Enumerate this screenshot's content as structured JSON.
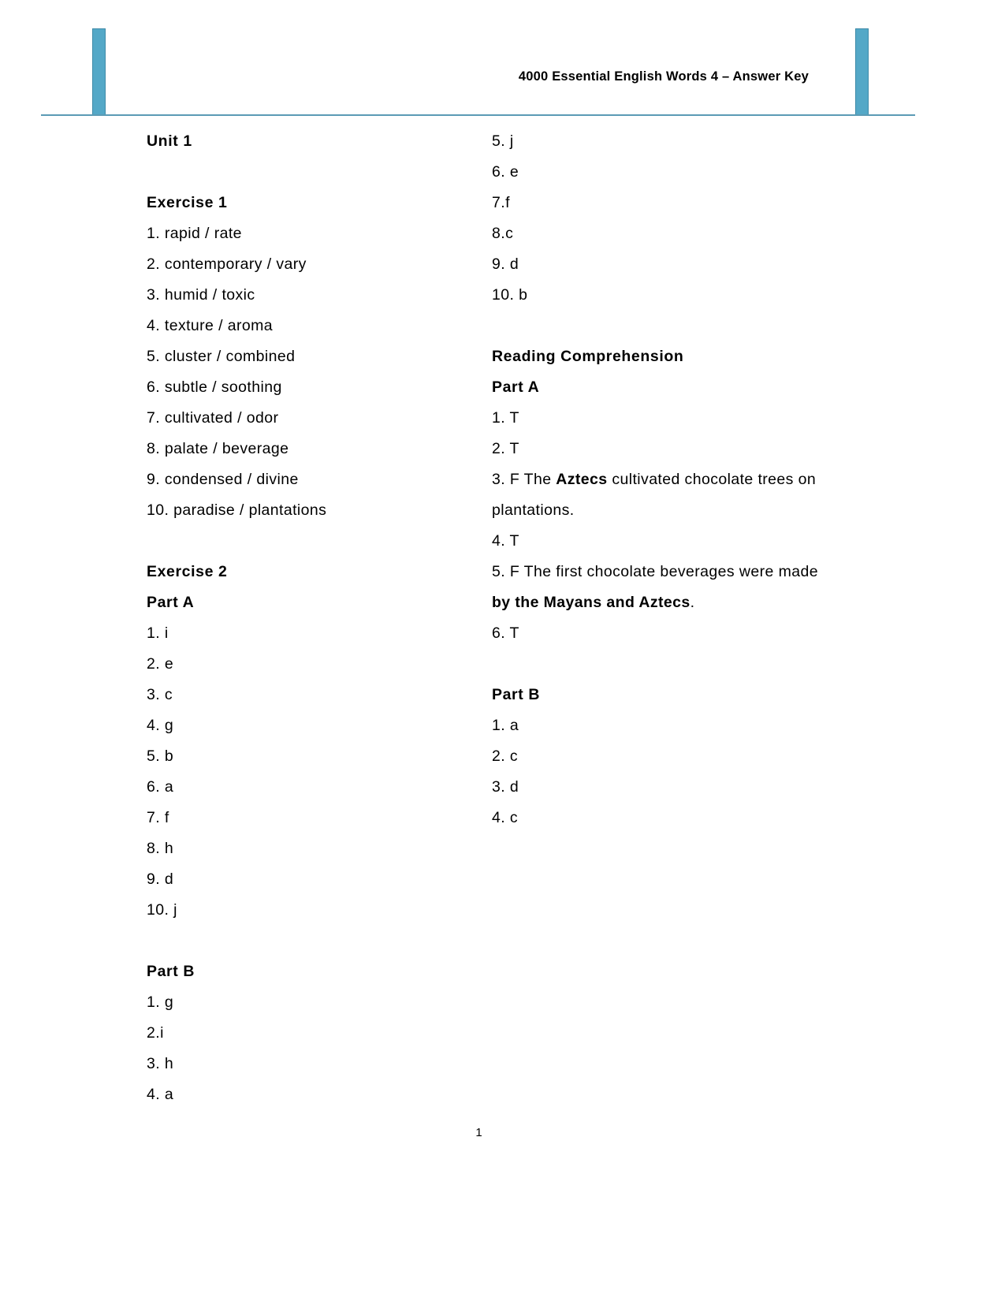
{
  "header": {
    "title": "4000 Essential English Words 4 – Answer Key",
    "accent_color": "#54a8c7",
    "rule_color": "#5b9bb5"
  },
  "footer": {
    "page_number": "1"
  },
  "left_column": {
    "unit_heading": "Unit 1",
    "exercise1": {
      "heading": "Exercise 1",
      "items": [
        "1. rapid / rate",
        "2. contemporary / vary",
        "3. humid / toxic",
        "4. texture / aroma",
        "5. cluster / combined",
        "6. subtle / soothing",
        "7. cultivated / odor",
        "8. palate / beverage",
        "9. condensed / divine",
        "10. paradise / plantations"
      ]
    },
    "exercise2": {
      "heading": "Exercise 2",
      "part_a": {
        "heading": "Part A",
        "items": [
          "1. i",
          "2. e",
          "3. c",
          "4. g",
          "5. b",
          "6. a",
          "7. f",
          "8. h",
          "9. d",
          "10. j"
        ]
      },
      "part_b": {
        "heading": "Part B",
        "items": [
          "1. g",
          "2.i",
          "3. h",
          "4. a"
        ]
      }
    }
  },
  "right_column": {
    "exercise2_part_b_continued": [
      "5. j",
      "6. e",
      "7.f",
      "8.c",
      "9. d",
      "10. b"
    ],
    "reading_comprehension": {
      "heading": "Reading Comprehension",
      "part_a": {
        "heading": "Part A",
        "items": [
          {
            "text": "1. T"
          },
          {
            "text": "2. T"
          },
          {
            "prefix": "3. F   The ",
            "bold": "Aztecs",
            "suffix": " cultivated chocolate trees on plantations."
          },
          {
            "text": "4. T"
          },
          {
            "prefix": "5. F   The first chocolate beverages were made ",
            "bold": "by the Mayans and Aztecs",
            "suffix": "."
          },
          {
            "text": "6. T"
          }
        ]
      },
      "part_b": {
        "heading": "Part B",
        "items": [
          "1. a",
          "2. c",
          "3. d",
          "4. c"
        ]
      }
    }
  }
}
